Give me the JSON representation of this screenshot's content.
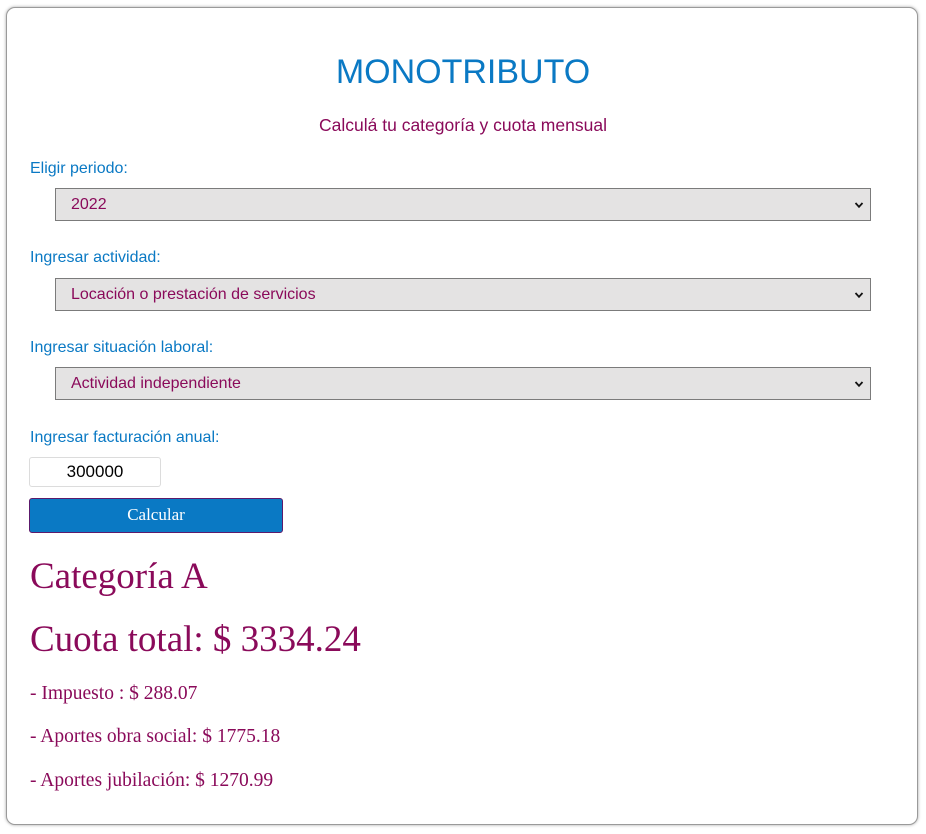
{
  "header": {
    "title": "MONOTRIBUTO",
    "subtitle": "Calculá tu categoría y cuota mensual"
  },
  "form": {
    "periodo": {
      "label": "Eligir periodo:",
      "selected": "2022"
    },
    "actividad": {
      "label": "Ingresar actividad:",
      "selected": "Locación o prestación de servicios"
    },
    "situacion": {
      "label": "Ingresar situación laboral:",
      "selected": "Actividad independiente"
    },
    "facturacion": {
      "label": "Ingresar facturación anual:",
      "value": "300000"
    },
    "calc_button": "Calcular"
  },
  "result": {
    "categoria": "Categoría A",
    "cuota_total": "Cuota total: $ 3334.24",
    "impuesto": "- Impuesto : $ 288.07",
    "obra_social": "- Aportes obra social: $ 1775.18",
    "jubilacion": "- Aportes jubilación: $ 1270.99"
  },
  "colors": {
    "accent_blue": "#0a79c4",
    "accent_magenta": "#8a0a5a",
    "select_bg": "#e4e3e3"
  },
  "icons": {
    "select_arrow": "chevron-down-icon"
  }
}
